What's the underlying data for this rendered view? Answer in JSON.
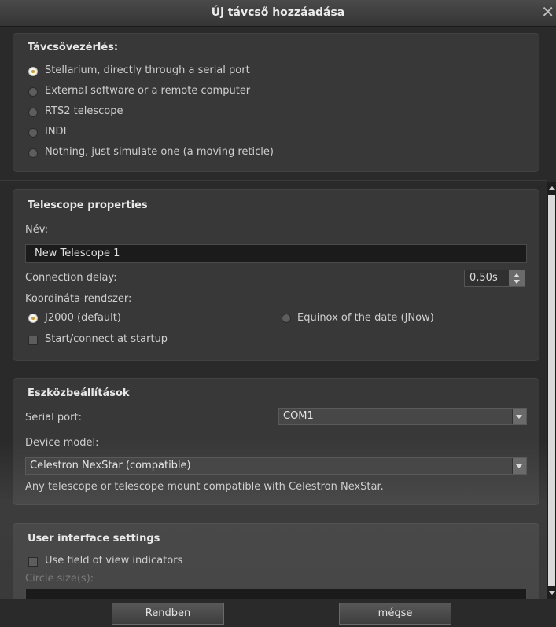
{
  "window": {
    "title": "Új távcső hozzáadása",
    "close_glyph": "✕"
  },
  "control": {
    "title": "Távcsővezérlés:",
    "options": [
      {
        "label": "Stellarium, directly through a serial port",
        "selected": true
      },
      {
        "label": "External software or a remote computer",
        "selected": false
      },
      {
        "label": "RTS2 telescope",
        "selected": false
      },
      {
        "label": "INDI",
        "selected": false
      },
      {
        "label": "Nothing, just simulate one (a moving reticle)",
        "selected": false
      }
    ]
  },
  "properties": {
    "title": "Telescope properties",
    "name_label": "Név:",
    "name_value": "New Telescope 1",
    "delay_label": "Connection delay:",
    "delay_value": "0,50s",
    "coord_label": "Koordináta-rendszer:",
    "coord_options": [
      {
        "label": "J2000 (default)",
        "selected": true
      },
      {
        "label": "Equinox of the date (JNow)",
        "selected": false
      }
    ],
    "startup_label": "Start/connect at startup",
    "startup_checked": false
  },
  "device": {
    "title": "Eszközbeállítások",
    "serial_label": "Serial port:",
    "serial_value": "COM1",
    "model_label": "Device model:",
    "model_value": "Celestron NexStar (compatible)",
    "model_desc": "Any telescope or telescope mount compatible with Celestron NexStar."
  },
  "ui_settings": {
    "title": "User interface settings",
    "fov_label": "Use field of view indicators",
    "fov_checked": false,
    "circle_label": "Circle size(s):"
  },
  "buttons": {
    "ok": "Rendben",
    "cancel": "mégse"
  },
  "colors": {
    "accent": "#e09a0c",
    "background": "#2a2a2a"
  }
}
